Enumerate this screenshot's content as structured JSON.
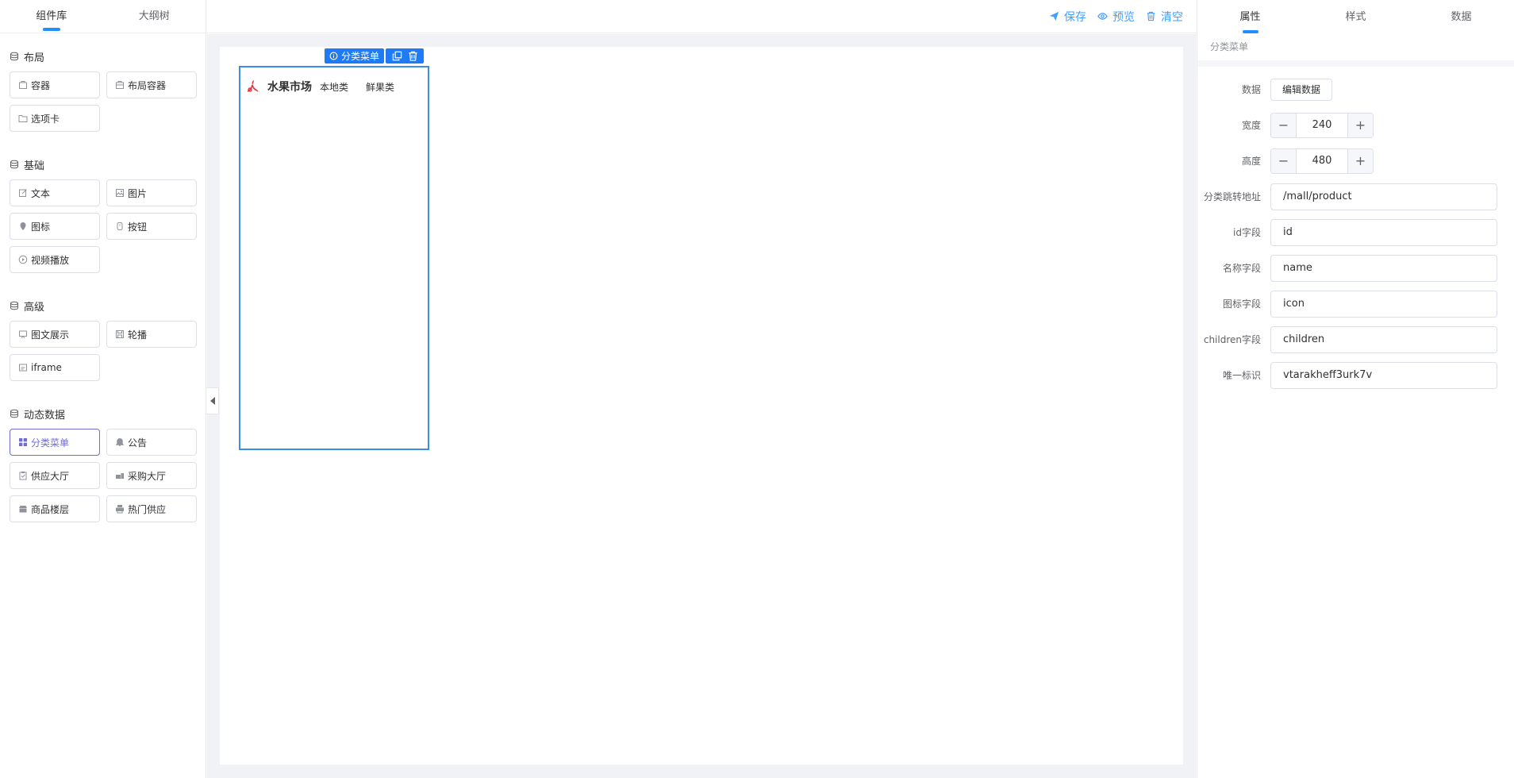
{
  "left_panel": {
    "tabs": [
      {
        "label": "组件库",
        "active": true
      },
      {
        "label": "大纲树",
        "active": false
      }
    ],
    "groups": [
      {
        "title": "布局",
        "items": [
          {
            "label": "容器",
            "icon": "box-icon"
          },
          {
            "label": "布局容器",
            "icon": "layout-icon"
          },
          {
            "label": "选项卡",
            "icon": "folder-icon"
          }
        ]
      },
      {
        "title": "基础",
        "items": [
          {
            "label": "文本",
            "icon": "edit-icon"
          },
          {
            "label": "图片",
            "icon": "image-icon"
          },
          {
            "label": "图标",
            "icon": "pin-icon"
          },
          {
            "label": "按钮",
            "icon": "button-icon"
          },
          {
            "label": "视频播放",
            "icon": "play-icon"
          }
        ]
      },
      {
        "title": "高级",
        "items": [
          {
            "label": "图文展示",
            "icon": "picture-text-icon"
          },
          {
            "label": "轮播",
            "icon": "carousel-icon"
          },
          {
            "label": "iframe",
            "icon": "iframe-icon"
          }
        ]
      },
      {
        "title": "动态数据",
        "items": [
          {
            "label": "分类菜单",
            "icon": "grid-icon",
            "active": true
          },
          {
            "label": "公告",
            "icon": "bell-icon"
          },
          {
            "label": "供应大厅",
            "icon": "clipboard-icon"
          },
          {
            "label": "采购大厅",
            "icon": "cart-icon"
          },
          {
            "label": "商品楼层",
            "icon": "shop-icon"
          },
          {
            "label": "热门供应",
            "icon": "printer-icon"
          }
        ]
      }
    ]
  },
  "toolbar": {
    "save_label": "保存",
    "preview_label": "预览",
    "clear_label": "清空"
  },
  "canvas": {
    "selection": {
      "name": "分类菜单"
    },
    "category_widget": {
      "title": "水果市场",
      "items": [
        "本地类",
        "鲜果类"
      ]
    }
  },
  "right_panel": {
    "tabs": [
      {
        "label": "属性",
        "active": true
      },
      {
        "label": "样式",
        "active": false
      },
      {
        "label": "数据",
        "active": false
      }
    ],
    "component_name": "分类菜单",
    "fields": {
      "data": {
        "label": "数据",
        "button": "编辑数据"
      },
      "width": {
        "label": "宽度",
        "value": "240"
      },
      "height": {
        "label": "高度",
        "value": "480"
      },
      "jump_url": {
        "label": "分类跳转地址",
        "value": "/mall/product"
      },
      "id_field": {
        "label": "id字段",
        "value": "id"
      },
      "name_field": {
        "label": "名称字段",
        "value": "name"
      },
      "icon_field": {
        "label": "图标字段",
        "value": "icon"
      },
      "children_field": {
        "label": "children字段",
        "value": "children"
      },
      "unique_id": {
        "label": "唯一标识",
        "value": "vtarakheff3urk7v"
      }
    }
  },
  "colors": {
    "primary": "#409eff",
    "selection": "#1e7bf5",
    "active_component": "#6f6cd8",
    "category_icon": "#e0383e"
  }
}
